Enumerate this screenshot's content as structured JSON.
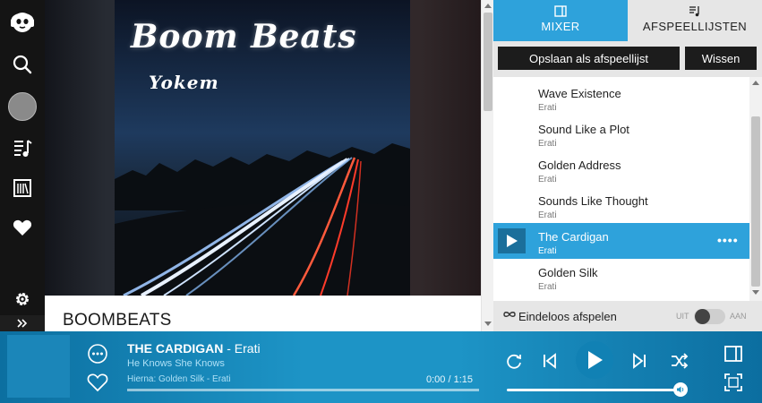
{
  "colors": {
    "accent": "#2ea2db",
    "nav_bg": "#141414",
    "player_bar": "#1d94c6",
    "button_dark": "#1c1c1c"
  },
  "nav": {
    "items": [
      {
        "name": "logo",
        "icon": "headphones-cat-icon"
      },
      {
        "name": "search",
        "icon": "search-icon"
      },
      {
        "name": "profile",
        "icon": "avatar"
      },
      {
        "name": "music",
        "icon": "music-list-icon"
      },
      {
        "name": "library",
        "icon": "library-icon"
      },
      {
        "name": "favorites",
        "icon": "heart-icon"
      },
      {
        "name": "settings",
        "icon": "gear-icon"
      },
      {
        "name": "expand",
        "icon": "chevron-double-right-icon"
      }
    ]
  },
  "main": {
    "album_art": {
      "title": "Boom Beats",
      "subtitle": "Yokem"
    },
    "page_title": "BOOMBEATS"
  },
  "panel": {
    "tabs": [
      {
        "label": "MIXER",
        "icon": "panel-icon",
        "active": true
      },
      {
        "label": "AFSPEELLIJSTEN",
        "icon": "playlist-icon",
        "active": false
      }
    ],
    "save_label": "Opslaan als afspeellijst",
    "clear_label": "Wissen",
    "queue": [
      {
        "title": "Wave Existence",
        "artist": "Erati"
      },
      {
        "title": "Sound Like a Plot",
        "artist": "Erati"
      },
      {
        "title": "Golden Address",
        "artist": "Erati"
      },
      {
        "title": "Sounds Like Thought",
        "artist": "Erati"
      },
      {
        "title": "The Cardigan",
        "artist": "Erati",
        "active": true
      },
      {
        "title": "Golden Silk",
        "artist": "Erati"
      }
    ],
    "endless": {
      "label": "Eindeloos afspelen",
      "off_label": "UIT",
      "on_label": "AAN",
      "enabled": false
    }
  },
  "player": {
    "title": "THE CARDIGAN",
    "artist_suffix": " - Erati",
    "album": "He Knows She Knows",
    "next_up": "Hierna: Golden Silk - Erati",
    "time": "0:00 / 1:15",
    "progress": 0.0,
    "volume": 1.0,
    "icons": [
      "more-icon",
      "heart-outline-icon",
      "repeat-icon",
      "previous-icon",
      "play-icon",
      "next-icon",
      "shuffle-icon",
      "panel-toggle-icon",
      "fullscreen-icon",
      "volume-icon"
    ]
  }
}
